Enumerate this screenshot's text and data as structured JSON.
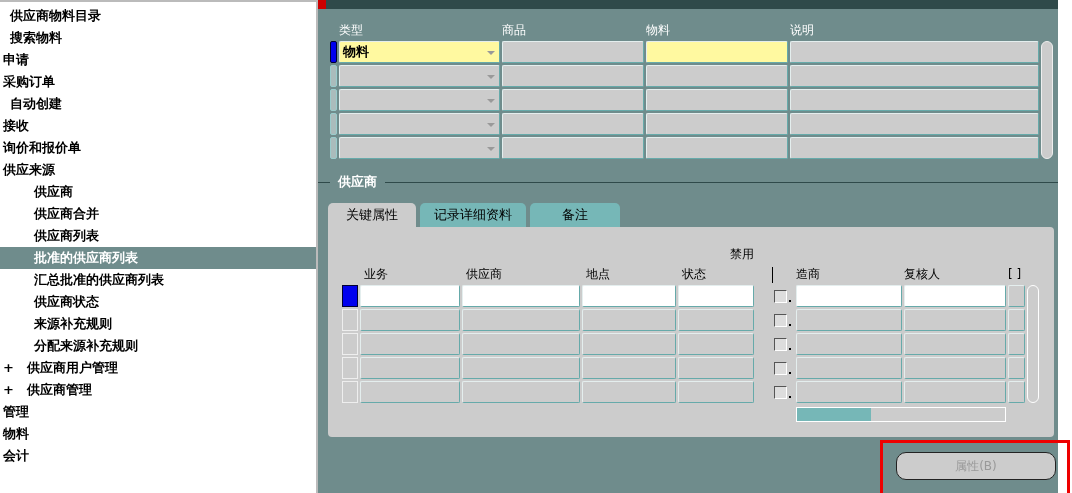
{
  "sidebar": {
    "items": [
      {
        "label": "供应商物料目录",
        "kind": "sub_entry",
        "selected": false
      },
      {
        "label": "搜索物料",
        "kind": "sub_entry",
        "selected": false
      },
      {
        "label": "申请",
        "kind": "entry",
        "selected": false
      },
      {
        "label": "采购订单",
        "kind": "entry",
        "selected": false,
        "children": [
          {
            "label": "自动创建",
            "kind": "sub_entry",
            "selected": false
          }
        ]
      },
      {
        "label": "接收",
        "kind": "entry",
        "selected": false
      },
      {
        "label": "询价和报价单",
        "kind": "entry",
        "selected": false
      },
      {
        "label": "供应来源",
        "kind": "entry",
        "selected": false,
        "children": [
          {
            "label": "供应商",
            "kind": "leaf",
            "selected": false
          },
          {
            "label": "供应商合并",
            "kind": "leaf",
            "selected": false
          },
          {
            "label": "供应商列表",
            "kind": "leaf",
            "selected": false
          },
          {
            "label": "批准的供应商列表",
            "kind": "leaf",
            "selected": true
          },
          {
            "label": "汇总批准的供应商列表",
            "kind": "leaf",
            "selected": false
          },
          {
            "label": "供应商状态",
            "kind": "leaf",
            "selected": false
          },
          {
            "label": "来源补充规则",
            "kind": "leaf",
            "selected": false
          },
          {
            "label": "分配来源补充规则",
            "kind": "leaf",
            "selected": false
          },
          {
            "label": "供应商用户管理",
            "kind": "folder",
            "expander": "+",
            "selected": false
          },
          {
            "label": "供应商管理",
            "kind": "folder",
            "expander": "+",
            "selected": false
          }
        ]
      },
      {
        "label": "管理",
        "kind": "entry",
        "selected": false
      },
      {
        "label": "物料",
        "kind": "entry",
        "selected": false
      },
      {
        "label": "会计",
        "kind": "entry",
        "selected": false
      }
    ]
  },
  "items_table": {
    "columns": [
      "类型",
      "商品",
      "物料",
      "说明"
    ],
    "rows": [
      {
        "selected": true,
        "type": "物料"
      },
      {
        "selected": false
      },
      {
        "selected": false
      },
      {
        "selected": false
      },
      {
        "selected": false
      }
    ]
  },
  "supplier_section": {
    "title": "供应商",
    "tabs": [
      {
        "label": "关键属性",
        "selected": true
      },
      {
        "label": "记录详细资料",
        "selected": false
      },
      {
        "label": "备注",
        "selected": false
      }
    ],
    "disabled_header": "禁用",
    "columns": [
      "业务",
      "供应商",
      "地点",
      "状态",
      "造商",
      "复核人",
      "[ ]"
    ],
    "rows": [
      {
        "selected": true,
        "disabled_checked": false
      },
      {
        "selected": false,
        "disabled_checked": false
      },
      {
        "selected": false,
        "disabled_checked": false
      },
      {
        "selected": false,
        "disabled_checked": false
      },
      {
        "selected": false,
        "disabled_checked": false
      }
    ]
  },
  "attributes_button": {
    "label": "属性(B)",
    "disabled": true
  }
}
